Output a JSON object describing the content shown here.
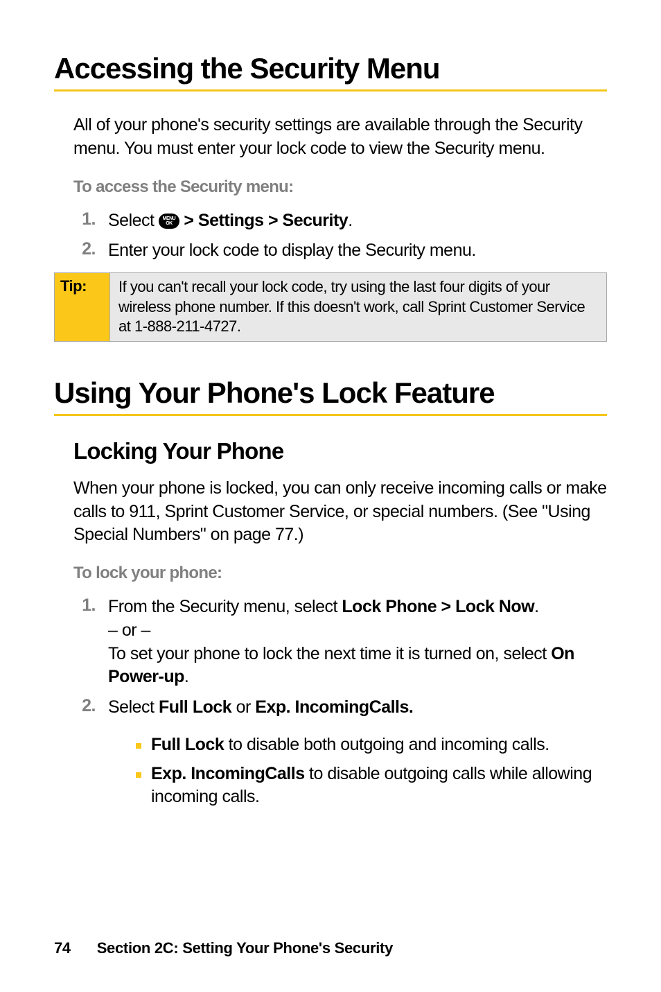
{
  "heading1": "Accessing the Security Menu",
  "intro_para": "All of your phone's security settings are available through the Security menu. You must enter your lock code to view the Security menu.",
  "subhead1": "To access the Security menu:",
  "step1_1_num": "1.",
  "step1_1_before": "Select ",
  "menu_icon_top": "MENU",
  "menu_icon_bottom": "OK",
  "step1_1_bold": " > Settings > Security",
  "step1_1_after": ".",
  "step1_2_num": "2.",
  "step1_2": "Enter your lock code to display the Security menu.",
  "tip_label": "Tip:",
  "tip_body": "If you can't recall your lock code, try using the last four digits of your wireless phone number. If this doesn't work, call Sprint Customer Service at 1-888-211-4727.",
  "heading2": "Using Your Phone's Lock Feature",
  "subheading2": "Locking Your Phone",
  "body2": "When your phone is locked, you can only receive incoming calls or make calls to 911, Sprint Customer Service, or special numbers. (See \"Using Special Numbers\" on page 77.)",
  "subhead2": "To lock your phone:",
  "step2_1_num": "1.",
  "step2_1_a_before": "From the Security menu, select ",
  "step2_1_a_bold": "Lock Phone > Lock Now",
  "step2_1_a_after": ".",
  "step2_1_or": "– or –",
  "step2_1_b_before": "To set your phone to lock the next time it is turned on, select ",
  "step2_1_b_bold": "On Power-up",
  "step2_1_b_after": ".",
  "step2_2_num": "2.",
  "step2_2_before": "Select ",
  "step2_2_bold1": "Full Lock",
  "step2_2_mid": " or ",
  "step2_2_bold2": "Exp. IncomingCalls.",
  "bullet1_bold": "Full Lock",
  "bullet1_after": " to disable both outgoing and incoming calls.",
  "bullet2_bold": "Exp. IncomingCalls",
  "bullet2_after": " to disable outgoing calls while allowing incoming calls.",
  "footer_page": "74",
  "footer_text": "Section 2C: Setting Your Phone's Security"
}
